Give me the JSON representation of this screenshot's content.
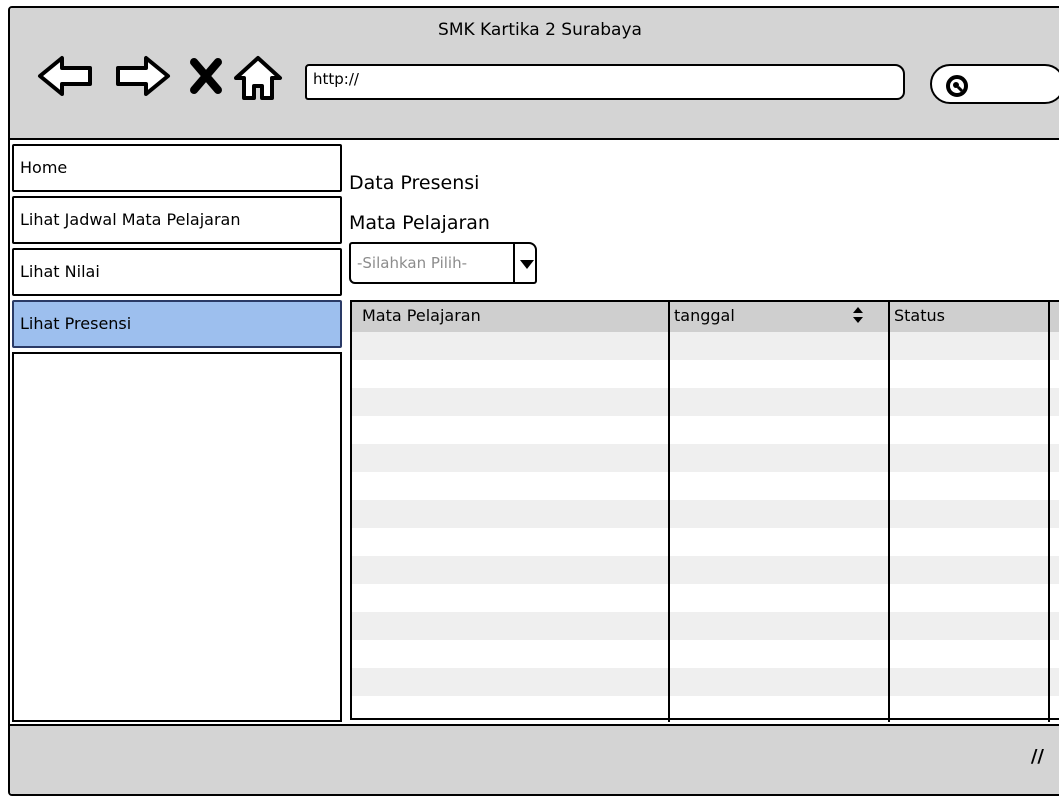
{
  "window": {
    "title": "SMK Kartika 2 Surabaya",
    "url": "http://",
    "search_placeholder": ""
  },
  "toolbar": {
    "icons": [
      "back-icon",
      "forward-icon",
      "stop-icon",
      "home-icon"
    ]
  },
  "sidebar": {
    "items": [
      {
        "label": "Home",
        "active": false
      },
      {
        "label": "Lihat Jadwal Mata Pelajaran",
        "active": false
      },
      {
        "label": "Lihat Nilai",
        "active": false
      },
      {
        "label": "Lihat Presensi",
        "active": true
      }
    ]
  },
  "main": {
    "heading": "Data Presensi",
    "subject_label": "Mata Pelajaran",
    "subject_select": {
      "value": "-Silahkan Pilih-"
    },
    "table": {
      "columns": [
        "Mata Pelajaran",
        "tanggal",
        "Status"
      ],
      "rows": []
    }
  },
  "colors": {
    "chrome": "#d4d4d4",
    "active_nav": "#9dbfee",
    "stripe": "#efefef",
    "header": "#cfcfcf"
  }
}
